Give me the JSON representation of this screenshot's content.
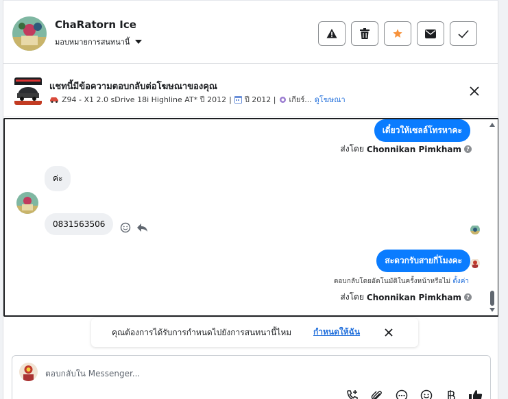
{
  "header": {
    "contact_name": "ChaRatorn Ice",
    "assign_label": "มอบหมายการสนทนานี้",
    "actions": [
      "warning-icon",
      "trash-icon",
      "star-icon",
      "envelope-icon",
      "check-icon"
    ],
    "accent_star": "#f7923b"
  },
  "ad": {
    "title": "แชทนี้มีข้อความตอบกลับต่อโฆษณาของคุณ",
    "subtitle_model": "Z94 - X1 2.0 sDrive 18i Highline AT* ปี 2012",
    "subtitle_year": "ปี 2012 |",
    "subtitle_gear": "เกียร์...",
    "view_ad_link": "ดูโฆษณา"
  },
  "conversation": {
    "messages": [
      {
        "direction": "out",
        "text": "เดี๋ยวให้เซลล์โทรหาคะ"
      },
      {
        "direction": "in",
        "text": "ค่ะ"
      },
      {
        "direction": "in",
        "text": "0831563506"
      },
      {
        "direction": "out",
        "text": "สะดวกรับสายกี่โมงคะ"
      }
    ],
    "sent_by_prefix": "ส่งโดย",
    "sent_by_name": "Chonnikan Pimkham",
    "auto_note": "ตอบกลับโดยอัตโนมัติในครั้งหน้าหรือไม่",
    "auto_note_link": "ตั้งค่า",
    "outgoing_color": "#0a7cff"
  },
  "banner": {
    "text": "คุณต้องการได้รับการกำหนดไปยังการสนทนานี้ไหม",
    "link": "กำหนดให้ฉัน"
  },
  "composer": {
    "placeholder": "ตอบกลับใน Messenger...",
    "tools": [
      "call-add-icon",
      "attachment-icon",
      "more-icon",
      "emoji-icon",
      "baht-icon",
      "like-icon"
    ]
  }
}
